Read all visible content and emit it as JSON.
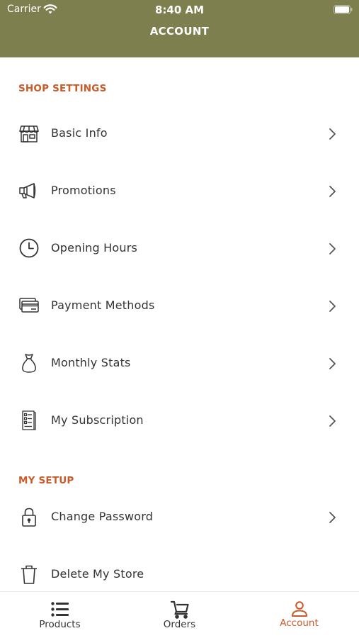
{
  "status_bar": {
    "carrier": "Carrier",
    "time": "8:40 AM"
  },
  "header": {
    "title": "ACCOUNT"
  },
  "sections": [
    {
      "title": "SHOP SETTINGS",
      "items": [
        {
          "label": "Basic Info",
          "icon": "store-icon"
        },
        {
          "label": "Promotions",
          "icon": "megaphone-icon"
        },
        {
          "label": "Opening Hours",
          "icon": "clock-icon"
        },
        {
          "label": "Payment Methods",
          "icon": "credit-cards-icon"
        },
        {
          "label": "Monthly Stats",
          "icon": "money-bag-icon"
        },
        {
          "label": "My Subscription",
          "icon": "document-list-icon"
        }
      ]
    },
    {
      "title": "MY SETUP",
      "items": [
        {
          "label": "Change Password",
          "icon": "lock-icon"
        },
        {
          "label": "Delete My Store",
          "icon": "trash-icon"
        }
      ]
    }
  ],
  "tabbar": {
    "tabs": [
      {
        "label": "Products",
        "icon": "list-icon"
      },
      {
        "label": "Orders",
        "icon": "cart-icon"
      },
      {
        "label": "Account",
        "icon": "user-icon",
        "active": true
      }
    ]
  },
  "colors": {
    "header_bg": "#7d7f4e",
    "accent": "#cc5a28",
    "text": "#333333"
  }
}
